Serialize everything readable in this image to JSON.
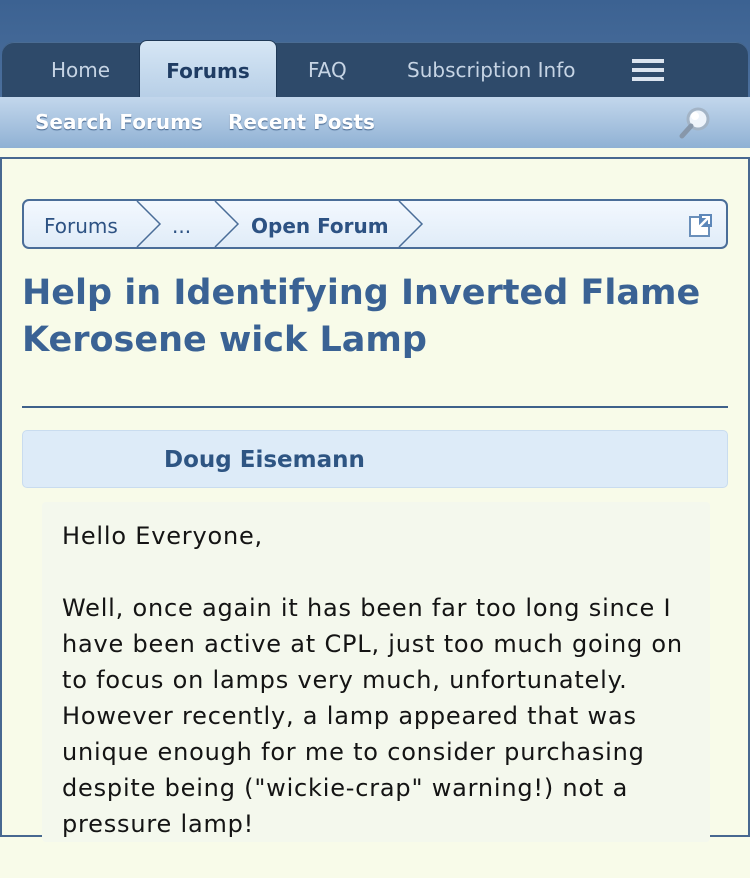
{
  "nav": {
    "tabs": [
      {
        "label": "Home"
      },
      {
        "label": "Forums",
        "active": true
      },
      {
        "label": "FAQ"
      },
      {
        "label": "Subscription Info"
      }
    ],
    "menu_icon": "hamburger-menu-icon"
  },
  "subnav": {
    "links": [
      "Search Forums",
      "Recent Posts"
    ],
    "search_icon": "magnifier-icon"
  },
  "breadcrumb": {
    "items": [
      "Forums",
      "...",
      "Open Forum"
    ],
    "icon": "open-external-icon"
  },
  "thread": {
    "title": "Help in Identifying Inverted Flame Kerosene wick Lamp"
  },
  "post": {
    "author": "Doug Eisemann",
    "greeting": "Hello Everyone,",
    "body": "Well, once again it has been far too long since I have been active at CPL, just too much going on to focus on lamps very much, unfortunately. However recently, a lamp appeared that was unique enough for me to consider purchasing despite being (\"wickie-crap\" warning!) not a pressure lamp!"
  },
  "colors": {
    "header_blue": "#3c6292",
    "nav_dark": "#2e4a6a",
    "title_blue": "#3a6294",
    "page_background": "#f8fbe9"
  }
}
